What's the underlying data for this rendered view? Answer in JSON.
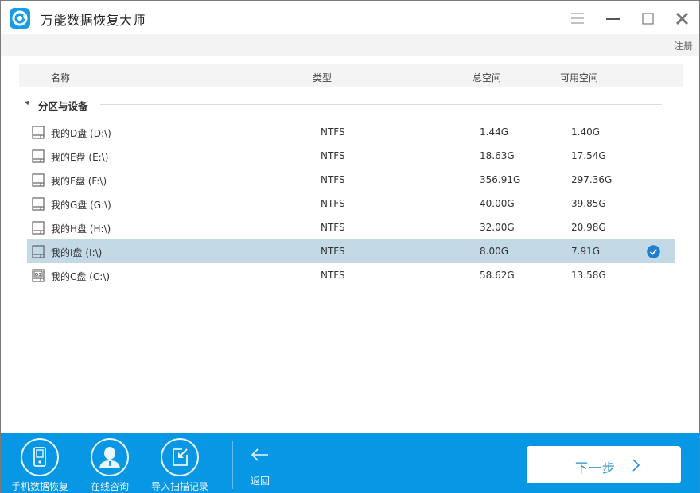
{
  "app": {
    "title": "万能数据恢复大师",
    "register_label": "注册",
    "accent_color": "#0897e4",
    "selected_row_color": "#c4d9e6"
  },
  "window_controls": {
    "menu": "menu-icon",
    "minimize": "minimize-icon",
    "maximize": "maximize-icon",
    "close": "close-icon"
  },
  "table": {
    "columns": [
      "名称",
      "类型",
      "总空间",
      "可用空间"
    ],
    "group": {
      "label": "分区与设备",
      "expanded": true
    },
    "rows": [
      {
        "name": "我的D盘 (D:\\)",
        "type": "NTFS",
        "total": "1.44G",
        "free": "1.40G",
        "icon": "disk-icon",
        "selected": false
      },
      {
        "name": "我的E盘 (E:\\)",
        "type": "NTFS",
        "total": "18.63G",
        "free": "17.54G",
        "icon": "disk-icon",
        "selected": false
      },
      {
        "name": "我的F盘 (F:\\)",
        "type": "NTFS",
        "total": "356.91G",
        "free": "297.36G",
        "icon": "disk-icon",
        "selected": false
      },
      {
        "name": "我的G盘 (G:\\)",
        "type": "NTFS",
        "total": "40.00G",
        "free": "39.85G",
        "icon": "disk-icon",
        "selected": false
      },
      {
        "name": "我的H盘 (H:\\)",
        "type": "NTFS",
        "total": "32.00G",
        "free": "20.98G",
        "icon": "disk-icon",
        "selected": false
      },
      {
        "name": "我的I盘 (I:\\)",
        "type": "NTFS",
        "total": "8.00G",
        "free": "7.91G",
        "icon": "disk-icon",
        "selected": true
      },
      {
        "name": "我的C盘 (C:\\)",
        "type": "NTFS",
        "total": "58.62G",
        "free": "13.58G",
        "icon": "os-disk-icon",
        "selected": false
      }
    ]
  },
  "footer": {
    "tools": [
      {
        "label": "手机数据恢复",
        "icon": "phone-icon"
      },
      {
        "label": "在线咨询",
        "icon": "consultant-icon"
      },
      {
        "label": "导入扫描记录",
        "icon": "import-icon"
      }
    ],
    "back_label": "返回",
    "next_label": "下一步"
  }
}
